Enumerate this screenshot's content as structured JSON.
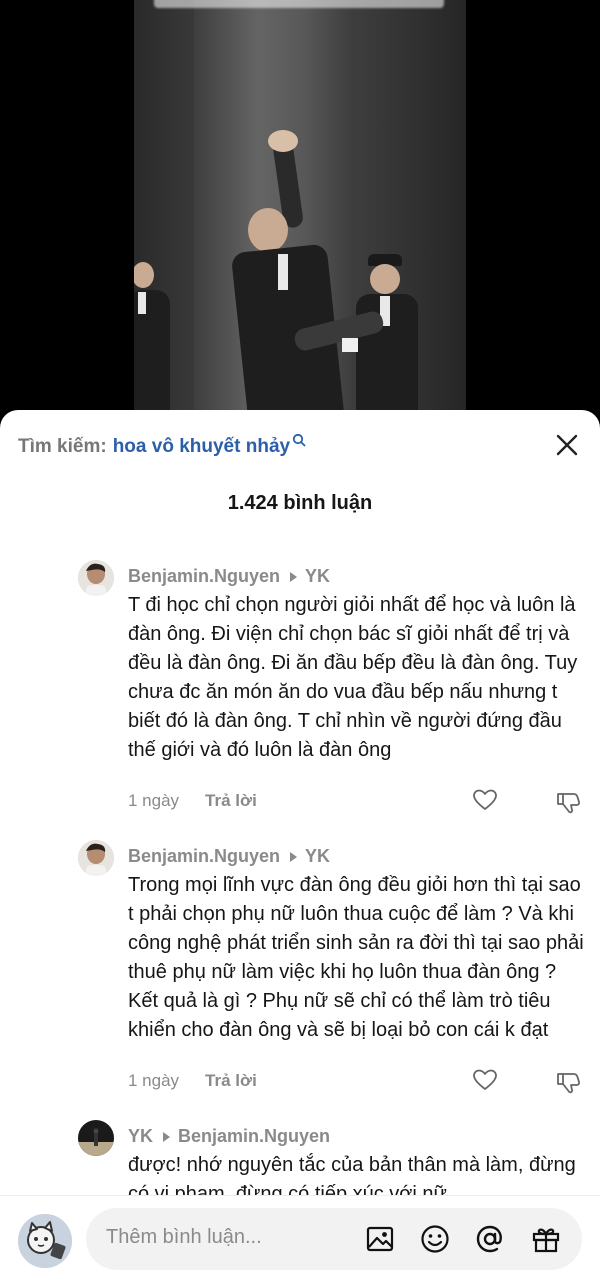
{
  "search": {
    "label": "Tìm kiếm:",
    "term": "hoa vô khuyết nhảy"
  },
  "count_label": "1.424 bình luận",
  "comments": [
    {
      "user": "Benjamin.Nguyen",
      "reply_to": "YK",
      "text": "T đi học chỉ chọn người giỏi nhất để học và luôn là đàn ông. Đi viện chỉ chọn bác sĩ giỏi nhất để trị và đều là đàn ông. Đi ăn đầu bếp đều là đàn ông. Tuy chưa đc ăn món ăn do vua đầu bếp nấu nhưng t biết đó là đàn ông. T chỉ nhìn về người đứng đầu thế giới và đó luôn là đàn ông",
      "time": "1 ngày",
      "reply_label": "Trả lời"
    },
    {
      "user": "Benjamin.Nguyen",
      "reply_to": "YK",
      "text": "Trong mọi lĩnh vực đàn ông đều giỏi hơn thì tại sao t phải chọn phụ nữ luôn thua cuộc để làm ? Và khi công nghệ phát triển sinh sản ra đời thì tại sao phải thuê phụ nữ làm việc khi họ luôn thua đàn ông ? Kết quả là gì ? Phụ nữ sẽ chỉ có thể làm trò tiêu khiển cho đàn ông và sẽ bị loại bỏ con cái k đạt",
      "time": "1 ngày",
      "reply_label": "Trả lời"
    },
    {
      "user": "YK",
      "reply_to": "Benjamin.Nguyen",
      "text": "được! nhớ nguyên tắc của bản thân mà làm, đừng có vi phạm, đừng có tiếp xúc với nữ,"
    }
  ],
  "input": {
    "placeholder": "Thêm bình luận..."
  },
  "colors": {
    "accent_link": "#2b5fa9",
    "muted": "#8a8a8a",
    "text": "#161616"
  },
  "icons": [
    "search-icon",
    "close-icon",
    "heart-icon",
    "thumbs-down-icon",
    "image-icon",
    "emoji-icon",
    "at-icon",
    "gift-icon"
  ]
}
